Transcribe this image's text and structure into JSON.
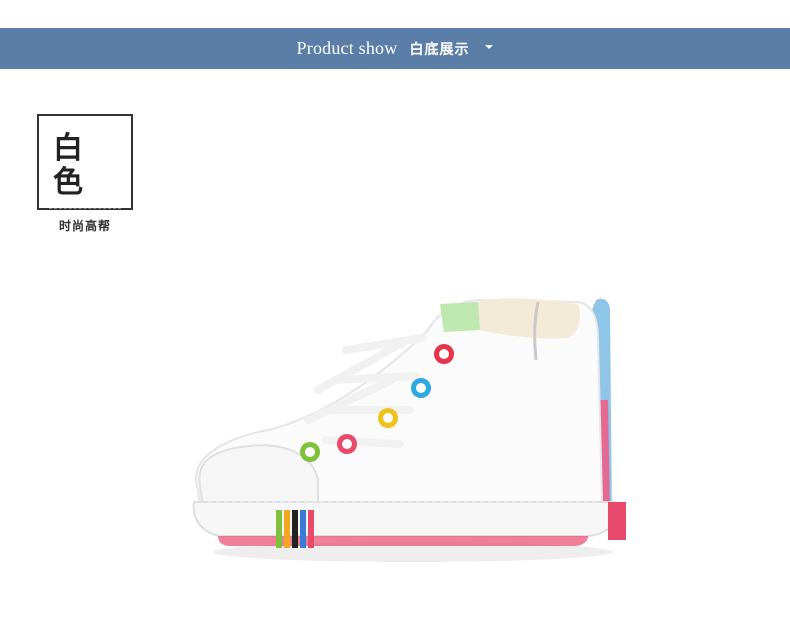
{
  "banner": {
    "title_en": "Product show",
    "title_cn": "白底展示",
    "background": "#5b7ea8"
  },
  "label": {
    "color_name": "白色",
    "style_name": "时尚高帮"
  },
  "product_image": {
    "icon": "shoe-image",
    "colors": {
      "canvas": "#ffffff",
      "eyelets": [
        "#e8334a",
        "#2ea8e0",
        "#f2c21b",
        "#e84a6c",
        "#7ec13a"
      ],
      "sole_stripes": [
        "#e84a6c",
        "#f5a623",
        "#3a7bd5",
        "#222222",
        "#7ec13a"
      ]
    }
  }
}
